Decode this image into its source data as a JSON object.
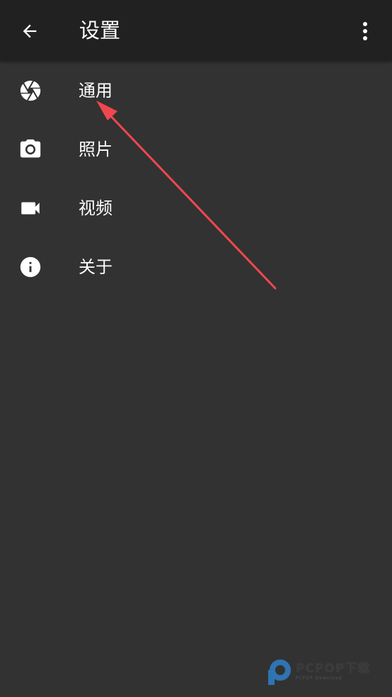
{
  "app_bar": {
    "title": "设置",
    "back_icon": "arrow-left-icon",
    "overflow_icon": "more-vertical-icon"
  },
  "menu": {
    "items": [
      {
        "label": "通用",
        "icon": "aperture-icon"
      },
      {
        "label": "照片",
        "icon": "camera-icon"
      },
      {
        "label": "视频",
        "icon": "videocam-icon"
      },
      {
        "label": "关于",
        "icon": "info-icon"
      }
    ]
  },
  "annotation": {
    "arrow_color": "#f0474f"
  },
  "watermark": {
    "text": "PCPOP下载",
    "subtext": "PCPOP Download"
  },
  "colors": {
    "app_bar_bg": "#212121",
    "screen_bg": "#323232",
    "text": "#ffffff"
  }
}
